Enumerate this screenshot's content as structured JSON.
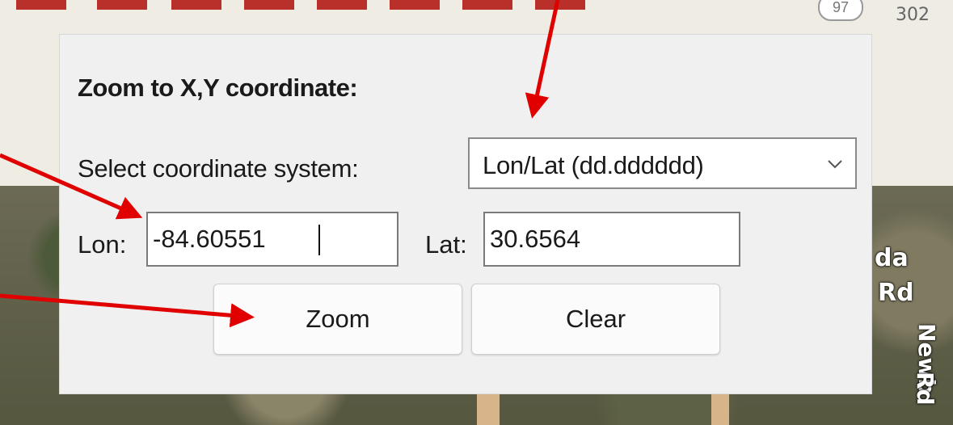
{
  "map": {
    "shields": [
      "97",
      "302"
    ],
    "street_labels": [
      "da",
      "Rd",
      "Newb",
      "Rd"
    ]
  },
  "panel": {
    "title": "Zoom to X,Y coordinate:",
    "select_label": "Select coordinate system:",
    "select_value": "Lon/Lat (dd.dddddd)",
    "lon_label": "Lon:",
    "lon_value": "-84.60551",
    "lat_label": "Lat:",
    "lat_value": "30.6564",
    "zoom_button": "Zoom",
    "clear_button": "Clear"
  },
  "colors": {
    "arrow": "#e00000",
    "panel_bg": "#f0f0f0"
  },
  "icons": {
    "select_chevron": "chevron-down-icon"
  }
}
